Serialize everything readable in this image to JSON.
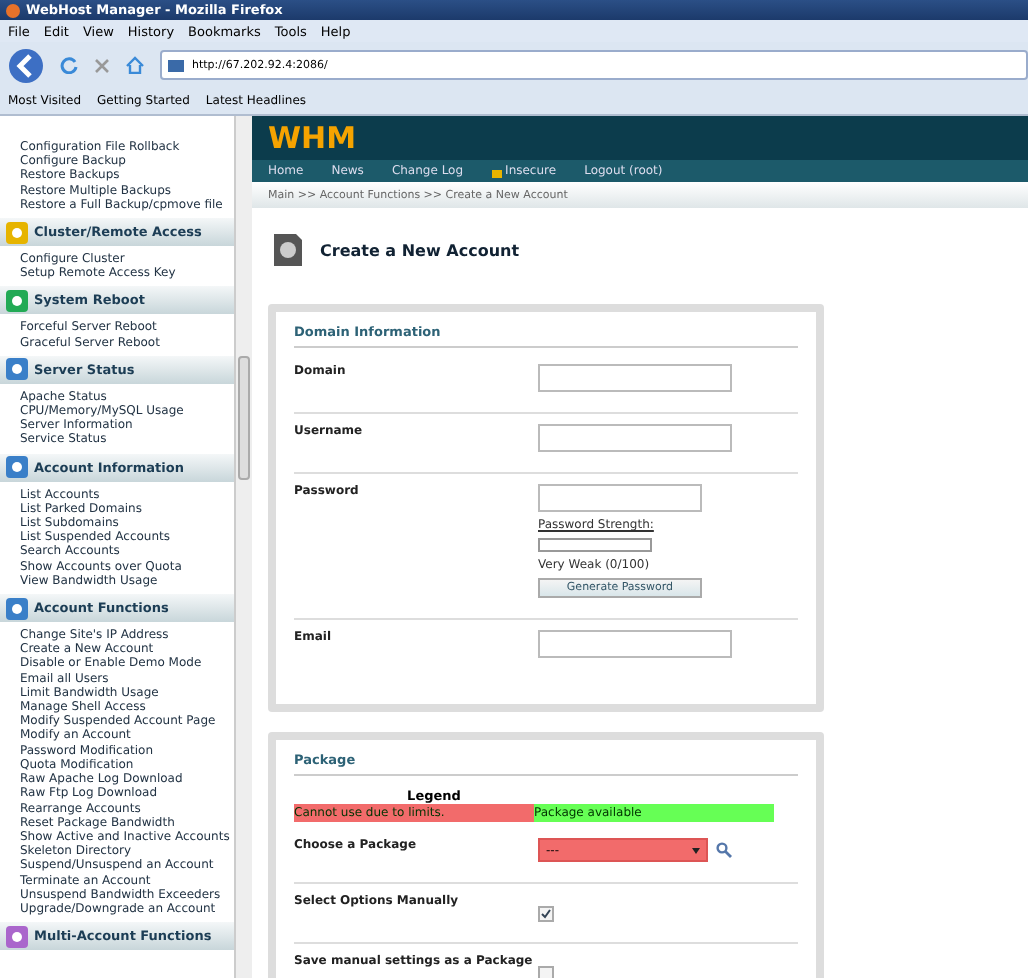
{
  "window": {
    "title": "WebHost Manager - Mozilla Firefox"
  },
  "menu": [
    "File",
    "Edit",
    "View",
    "History",
    "Bookmarks",
    "Tools",
    "Help"
  ],
  "address": {
    "value": "http://67.202.92.4:2086/"
  },
  "bookmarks": [
    "Most Visited",
    "Getting Started",
    "Latest Headlines"
  ],
  "sidebar": [
    {
      "items": [
        "Configuration File Rollback",
        "Configure Backup",
        "Restore Backups",
        "Restore Multiple Backups",
        "Restore a Full Backup/cpmove file"
      ]
    },
    {
      "title": "Cluster/Remote Access",
      "items": [
        "Configure Cluster",
        "Setup Remote Access Key"
      ]
    },
    {
      "title": "System Reboot",
      "items": [
        "Forceful Server Reboot",
        "Graceful Server Reboot"
      ]
    },
    {
      "title": "Server Status",
      "items": [
        "Apache Status",
        "CPU/Memory/MySQL Usage",
        "Server Information",
        "Service Status"
      ]
    },
    {
      "title": "Account Information",
      "items": [
        "List Accounts",
        "List Parked Domains",
        "List Subdomains",
        "List Suspended Accounts",
        "Search Accounts",
        "Show Accounts over Quota",
        "View Bandwidth Usage"
      ]
    },
    {
      "title": "Account Functions",
      "items": [
        "Change Site's IP Address",
        "Create a New Account",
        "Disable or Enable Demo Mode",
        "Email all Users",
        "Limit Bandwidth Usage",
        "Manage Shell Access",
        "Modify Suspended Account Page",
        "Modify an Account",
        "Password Modification",
        "Quota Modification",
        "Raw Apache Log Download",
        "Raw Ftp Log Download",
        "Rearrange Accounts",
        "Reset Package Bandwidth",
        "Show Active and Inactive Accounts",
        "Skeleton Directory",
        "Suspend/Unsuspend an Account",
        "Terminate an Account",
        "Unsuspend Bandwidth Exceeders",
        "Upgrade/Downgrade an Account"
      ]
    },
    {
      "title": "Multi-Account Functions"
    }
  ],
  "logo": "WHM",
  "nav": [
    "Home",
    "News",
    "Change Log",
    "Insecure",
    "Logout (root)"
  ],
  "breadcrumb": "Main >> Account Functions >> Create a New Account",
  "page_title": "Create a New Account",
  "domain_panel": {
    "title": "Domain Information",
    "rows": [
      {
        "kind": "text",
        "label": "Domain"
      },
      {
        "kind": "text",
        "label": "Username"
      },
      {
        "kind": "password",
        "label": "Password",
        "strength_label": "Password Strength:",
        "level": 0,
        "strength_text": "Very Weak (0/100)",
        "button": "Generate Password"
      },
      {
        "kind": "text",
        "label": "Email"
      }
    ]
  },
  "package_panel": {
    "title": "Package",
    "legend_title": "Legend",
    "legend": [
      {
        "text": "Cannot use due to limits.",
        "color": "#f26b6b"
      },
      {
        "text": "Package available",
        "color": "#66ff55"
      }
    ],
    "rows": [
      {
        "kind": "select",
        "label": "Choose a Package",
        "value": "---"
      },
      {
        "kind": "checkbox",
        "label": "Select Options Manually",
        "checked": true
      },
      {
        "kind": "checkbox",
        "label": "Save manual settings as a Package",
        "checked": false
      }
    ]
  }
}
